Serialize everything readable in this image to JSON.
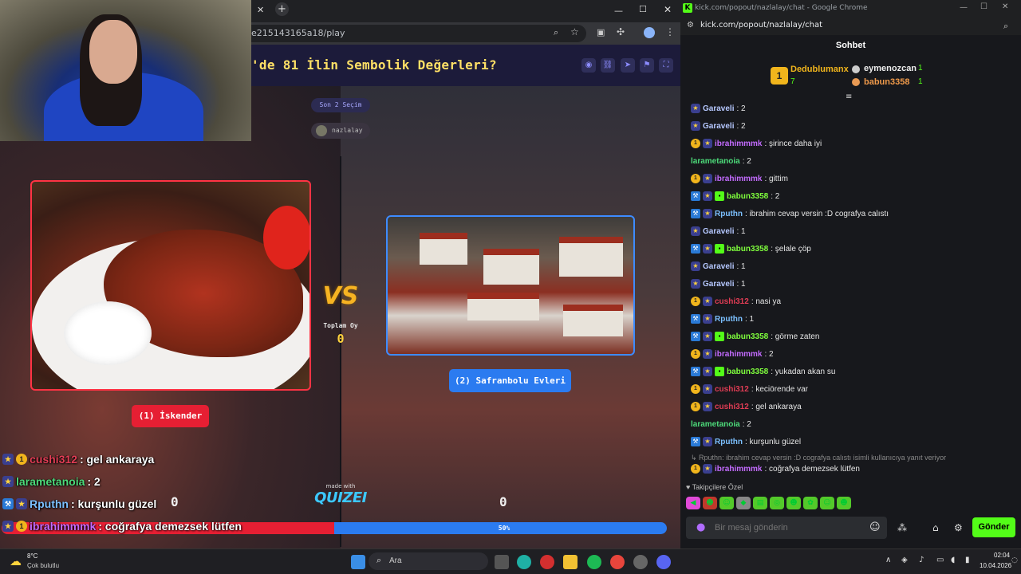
{
  "browser_left": {
    "url": "e215143165a18/play",
    "tab_close": "✕",
    "tab_new": "+"
  },
  "game": {
    "title": "'de 81 İlin Sembolik Değerleri?",
    "last_choice": "Son 2 Seçim",
    "user_chip": "nazlalay",
    "left_option": "(1) İskender",
    "right_option": "(2) Safranbolu Evleri",
    "vs": "VS",
    "total_votes_label": "Toplam Oy",
    "total_votes": "0",
    "left_count": "0",
    "right_count": "0",
    "progress_label": "50%",
    "progress_left_percent": 50,
    "made_with": "made with",
    "brand": "QUIZEI"
  },
  "overlay_chat": [
    {
      "name": "cushi312",
      "name_color": "#e23d55",
      "text": ": gel ankaraya",
      "badges": [
        "star",
        "coin"
      ]
    },
    {
      "name": "larametanoia",
      "name_color": "#4ddb7a",
      "text": ": 2",
      "badges": [
        "star"
      ]
    },
    {
      "name": "Rputhn",
      "name_color": "#7cc0ff",
      "text": ": kurşunlu güzel",
      "badges": [
        "mod",
        "star"
      ]
    },
    {
      "name": "ibrahimmmk",
      "name_color": "#c36bff",
      "text": ": coğrafya demezsek lütfen",
      "badges": [
        "star",
        "coin"
      ]
    }
  ],
  "browser_right": {
    "title": "kick.com/popout/nazlalay/chat - Google Chrome",
    "logo": "K",
    "url": "kick.com/popout/nazlalay/chat"
  },
  "chat": {
    "header": "Sohbet",
    "leaderboard": {
      "first_name": "Dedublumanx",
      "first_count": "7",
      "first_rank": "1",
      "second_name": "eymenozcan",
      "second_count": "1",
      "third_name": "babun3358",
      "third_count": "1"
    },
    "messages": [
      {
        "badges": [
          "star"
        ],
        "name": "Garaveli",
        "color": "#b6c8ff",
        "text": ": 2"
      },
      {
        "badges": [
          "star"
        ],
        "name": "Garaveli",
        "color": "#b6c8ff",
        "text": ": 2"
      },
      {
        "badges": [
          "coin",
          "star"
        ],
        "name": "ibrahimmmk",
        "color": "#c36bff",
        "text": ": şirince daha iyi"
      },
      {
        "badges": [],
        "name": "larametanoia",
        "color": "#4ddb7a",
        "text": ": 2"
      },
      {
        "badges": [
          "coin",
          "star"
        ],
        "name": "ibrahimmmk",
        "color": "#c36bff",
        "text": ": gittim"
      },
      {
        "badges": [
          "mod",
          "star",
          "green"
        ],
        "name": "babun3358",
        "color": "#7fff3d",
        "text": ": 2"
      },
      {
        "badges": [
          "mod",
          "star"
        ],
        "name": "Rputhn",
        "color": "#7cc0ff",
        "text": ": ibrahim cevap versin :D cografya calıstı"
      },
      {
        "badges": [
          "star"
        ],
        "name": "Garaveli",
        "color": "#b6c8ff",
        "text": ": 1"
      },
      {
        "badges": [
          "mod",
          "star",
          "green"
        ],
        "name": "babun3358",
        "color": "#7fff3d",
        "text": ": şelale çöp"
      },
      {
        "badges": [
          "star"
        ],
        "name": "Garaveli",
        "color": "#b6c8ff",
        "text": ": 1"
      },
      {
        "badges": [
          "star"
        ],
        "name": "Garaveli",
        "color": "#b6c8ff",
        "text": ": 1"
      },
      {
        "badges": [
          "coin",
          "star"
        ],
        "name": "cushi312",
        "color": "#e23d55",
        "text": ": nasi ya"
      },
      {
        "badges": [
          "mod",
          "star"
        ],
        "name": "Rputhn",
        "color": "#7cc0ff",
        "text": ": 1"
      },
      {
        "badges": [
          "mod",
          "star",
          "green"
        ],
        "name": "babun3358",
        "color": "#7fff3d",
        "text": ": görme zaten"
      },
      {
        "badges": [
          "coin",
          "star"
        ],
        "name": "ibrahimmmk",
        "color": "#c36bff",
        "text": ": 2"
      },
      {
        "badges": [
          "mod",
          "star",
          "green"
        ],
        "name": "babun3358",
        "color": "#7fff3d",
        "text": ": yukadan akan su"
      },
      {
        "badges": [
          "coin",
          "star"
        ],
        "name": "cushi312",
        "color": "#e23d55",
        "text": ": keciörende var"
      },
      {
        "badges": [
          "coin",
          "star"
        ],
        "name": "cushi312",
        "color": "#e23d55",
        "text": ": gel ankaraya"
      },
      {
        "badges": [],
        "name": "larametanoia",
        "color": "#4ddb7a",
        "text": ": 2"
      },
      {
        "badges": [
          "mod",
          "star"
        ],
        "name": "Rputhn",
        "color": "#7cc0ff",
        "text": ": kurşunlu güzel"
      }
    ],
    "reply_note": "↳ Rputhn: ibrahim cevap versin :D cografya calıstı isimli kullanıcıya yanıt veriyor",
    "reply_name": "ibrahimmmk",
    "reply_text": ": coğrafya demezsek lütfen",
    "followers_label": "♥ Takipçilere Özel",
    "input_placeholder": "Bir mesaj gönderin",
    "send_label": "Gönder"
  },
  "taskbar": {
    "weather_temp": "8°C",
    "weather_desc": "Çok bulutlu",
    "search_label": "Ara",
    "time": "02:04",
    "date": "10.04.2026"
  },
  "colors": {
    "kick_green": "#53fc18",
    "left_red": "#e61f33",
    "right_blue": "#2b7bf0",
    "title_yellow": "#ffe066"
  }
}
